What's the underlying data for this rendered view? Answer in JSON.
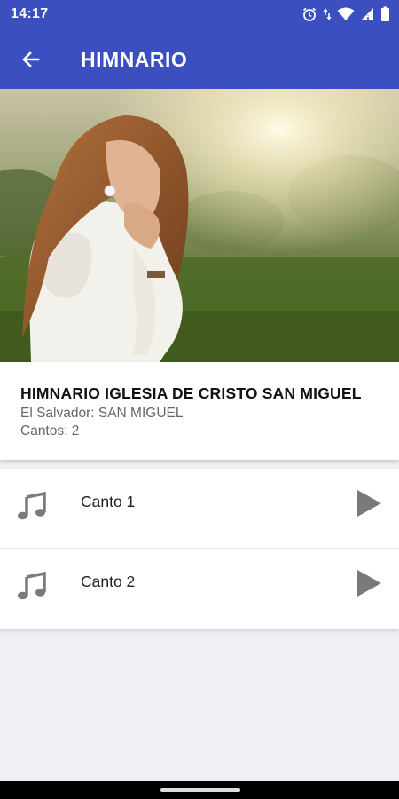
{
  "status_bar": {
    "time": "14:17",
    "icons": [
      "alarm-icon",
      "data-arrows-icon",
      "wifi-icon",
      "signal-icon",
      "battery-icon"
    ]
  },
  "app_bar": {
    "back_icon": "arrow-left-icon",
    "title": "HIMNARIO",
    "color": "#3b4fc0"
  },
  "hero": {
    "image_subject": "woman praying outdoors at sunset"
  },
  "hymnal": {
    "title": "HIMNARIO IGLESIA DE CRISTO SAN MIGUEL",
    "location": "El Salvador: SAN MIGUEL",
    "count": "Cantos: 2"
  },
  "songs": [
    {
      "label": "Canto 1",
      "icon": "music-note-icon",
      "action_icon": "play-icon"
    },
    {
      "label": "Canto 2",
      "icon": "music-note-icon",
      "action_icon": "play-icon"
    }
  ]
}
